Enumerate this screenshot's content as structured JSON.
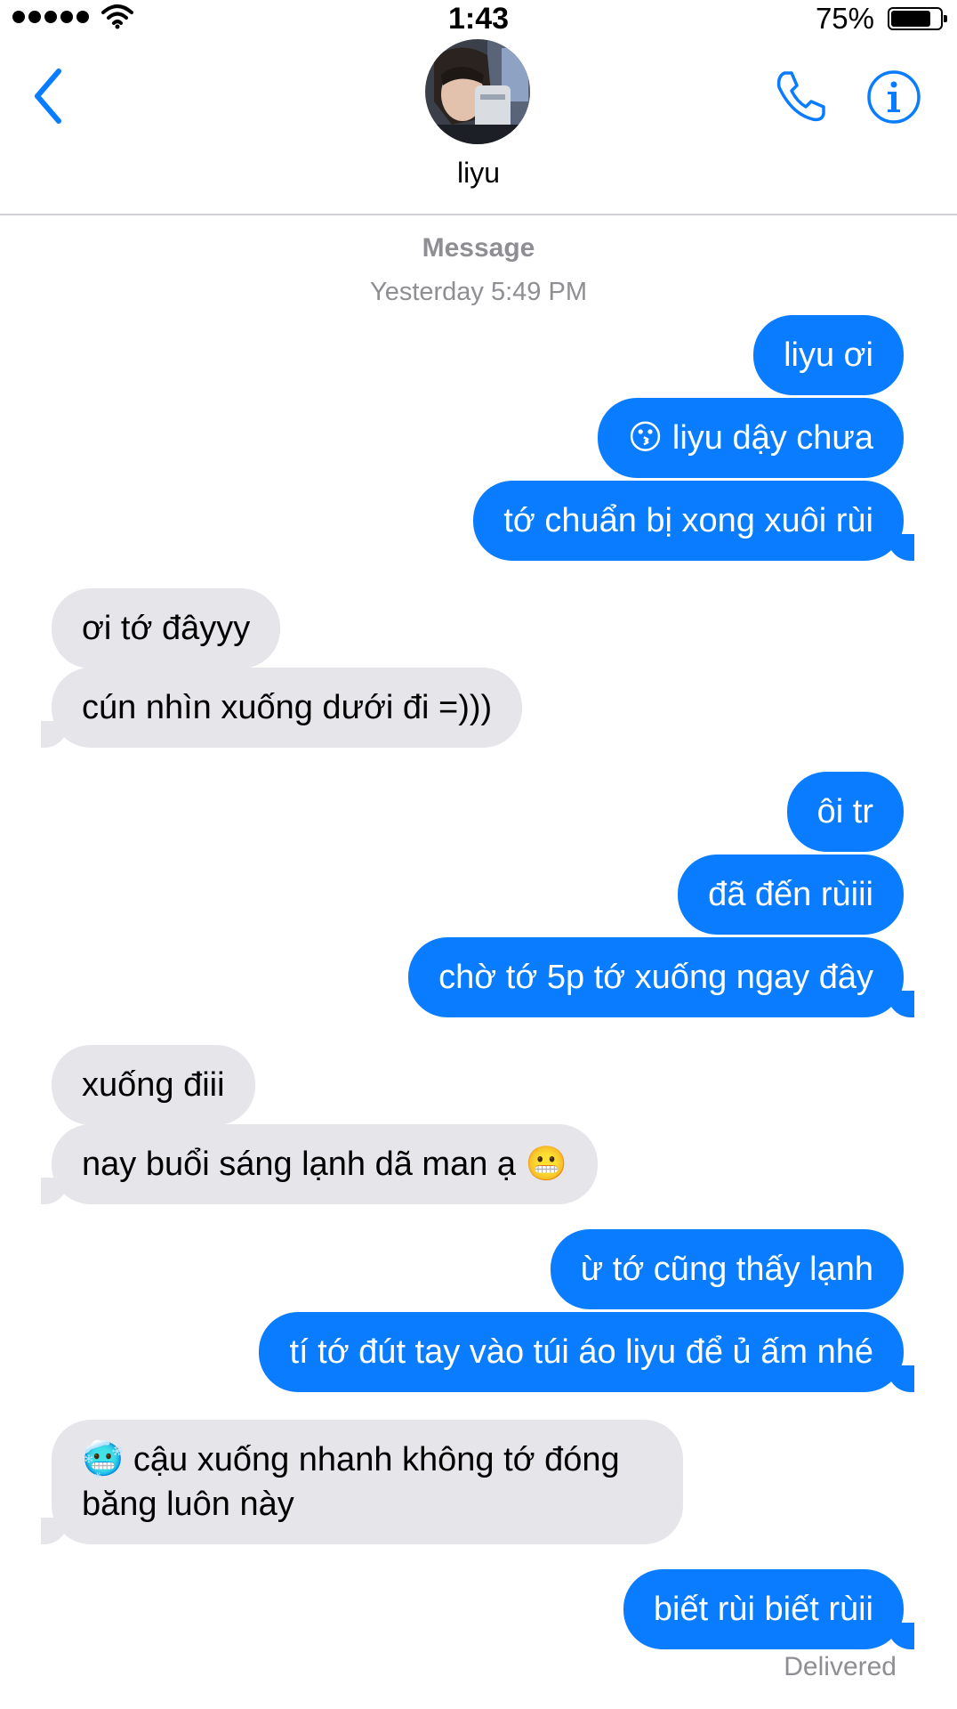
{
  "status_bar": {
    "time": "1:43",
    "battery": "75%"
  },
  "contact": {
    "name": "liyu"
  },
  "thread": {
    "title": "Message",
    "timestamp": "Yesterday 5:49 PM"
  },
  "messages": [
    {
      "from": "me",
      "text": "liyu ơi"
    },
    {
      "from": "me",
      "text": "😗 liyu dậy chưa"
    },
    {
      "from": "me",
      "text": "tớ chuẩn bị xong xuôi rùi"
    },
    {
      "from": "them",
      "text": "ơi tớ đâyyy"
    },
    {
      "from": "them",
      "text": "cún nhìn xuống dưới đi =)))"
    },
    {
      "from": "me",
      "text": "ôi tr"
    },
    {
      "from": "me",
      "text": "đã đến rùiii"
    },
    {
      "from": "me",
      "text": "chờ tớ 5p tớ xuống ngay đây"
    },
    {
      "from": "them",
      "text": "xuống điii"
    },
    {
      "from": "them",
      "text": "nay buổi sáng lạnh dã man ạ 😬"
    },
    {
      "from": "me",
      "text": "ừ tớ cũng thấy lạnh"
    },
    {
      "from": "me",
      "text": "tí tớ đút tay vào túi áo liyu để ủ ấm nhé"
    },
    {
      "from": "them",
      "text": "🥶 cậu xuống nhanh không tớ đóng băng luôn này"
    },
    {
      "from": "me",
      "text": "biết rùi biết rùii"
    }
  ],
  "delivery_status": "Delivered",
  "colors": {
    "outgoing": "#0a7cff",
    "incoming": "#e5e5ea",
    "accent": "#0a7cff"
  },
  "icons": [
    "back-chevron-icon",
    "phone-icon",
    "info-icon",
    "wifi-icon",
    "battery-icon"
  ]
}
